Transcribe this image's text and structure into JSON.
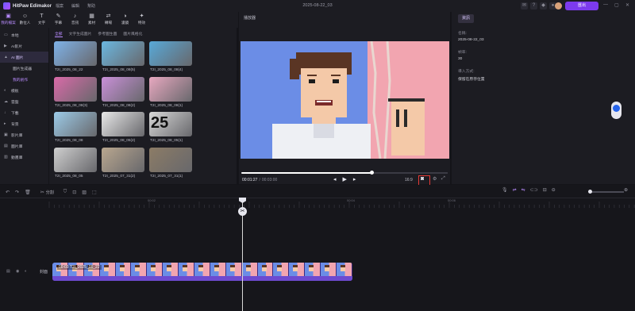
{
  "app": {
    "name": "HitPaw Edimakor",
    "menus": [
      "檔案",
      "編輯",
      "幫助"
    ],
    "project_title": "2025-08-22_03",
    "export_label": "匯出"
  },
  "toolbar": [
    {
      "icon": "folder-icon",
      "label": "我的檔案",
      "active": true
    },
    {
      "icon": "digital-human-icon",
      "label": "數位人"
    },
    {
      "icon": "text-icon",
      "label": "文字"
    },
    {
      "icon": "subtitle-icon",
      "label": "字幕"
    },
    {
      "icon": "audio-icon",
      "label": "音訊"
    },
    {
      "icon": "material-icon",
      "label": "素材"
    },
    {
      "icon": "transition-icon",
      "label": "轉場"
    },
    {
      "icon": "filter-icon",
      "label": "濾鏡"
    },
    {
      "icon": "effect-icon",
      "label": "特效"
    }
  ],
  "sidebar": [
    {
      "icon": "folder-icon",
      "label": "本地",
      "type": "item"
    },
    {
      "icon": "ai-icon",
      "label": "AI影片",
      "type": "item"
    },
    {
      "icon": "ai-image-icon",
      "label": "AI 圖片",
      "type": "active"
    },
    {
      "label": "圖片生成器",
      "type": "sub"
    },
    {
      "label": "我的創作",
      "type": "subactive"
    },
    {
      "icon": "template-icon",
      "label": "模板",
      "type": "item"
    },
    {
      "icon": "cloud-icon",
      "label": "雲盤",
      "type": "item"
    },
    {
      "icon": "download-icon",
      "label": "下載",
      "type": "item"
    },
    {
      "icon": "background-icon",
      "label": "背景",
      "type": "item"
    },
    {
      "icon": "video-library-icon",
      "label": "影片庫",
      "type": "item"
    },
    {
      "icon": "image-library-icon",
      "label": "圖片庫",
      "type": "item"
    },
    {
      "icon": "animation-icon",
      "label": "動畫庫",
      "type": "item"
    }
  ],
  "media_tabs": [
    {
      "label": "全部",
      "active": true
    },
    {
      "label": "文字生成圖片"
    },
    {
      "label": "參考圖生圖"
    },
    {
      "label": "圖片風格化"
    }
  ],
  "media_items": [
    {
      "caption": "T2I_2025_08_22",
      "color": "#7fb2e8"
    },
    {
      "caption": "T2I_2025_08_08(5)",
      "color": "#6bb7e0"
    },
    {
      "caption": "T2I_2025_08_08(4)",
      "color": "#58a9d8"
    },
    {
      "caption": "T2I_2025_08_08(3)",
      "color": "#d96aa8"
    },
    {
      "caption": "T2I_2025_08_08(2)",
      "color": "#c990d8"
    },
    {
      "caption": "T2I_2025_08_08(1)",
      "color": "#e8a8c0"
    },
    {
      "caption": "T2I_2025_08_08",
      "color": "#9ccbe8"
    },
    {
      "caption": "T2I_2025_08_05(2)",
      "color": "#e8e8e8"
    },
    {
      "caption": "T2I_2025_08_05(1)",
      "color": "#d8d8d8"
    },
    {
      "caption": "T2I_2025_08_05",
      "color": "#cfcfcf"
    },
    {
      "caption": "T2I_2025_07_31(2)",
      "color": "#b9a78f"
    },
    {
      "caption": "T2I_2025_07_31(1)",
      "color": "#8c7c66"
    }
  ],
  "media_thumb_text": "25",
  "preview": {
    "header": "播放器",
    "time_current": "00:01:27",
    "time_total": "00:03:00",
    "aspect": "16:9",
    "screenshot_label": "截圖",
    "progress": 0.55
  },
  "properties": {
    "tab": "資訊",
    "fields": [
      {
        "label": "名稱:",
        "value": "2025-08-22_03"
      },
      {
        "label": "幀率:",
        "value": "30"
      },
      {
        "label": "導入方式:",
        "value": "保留在原存位置"
      }
    ]
  },
  "timeline": {
    "tools": [
      "undo-icon",
      "redo-icon",
      "delete-icon",
      "split-icon",
      "shield-icon",
      "text-box-icon",
      "image-icon",
      "replace-icon"
    ],
    "split_label": "分割",
    "ruler_labels": [
      "00:00",
      "00:02",
      "00:04",
      "00:06"
    ],
    "track_label": "封面",
    "clip_label": "00:03 T2I_2025_08_22"
  },
  "colors": {
    "accent": "#7c3aed",
    "accent_text": "#b98cff",
    "panel": "#1c1c22",
    "background": "#141419",
    "highlight": "#e53935"
  }
}
